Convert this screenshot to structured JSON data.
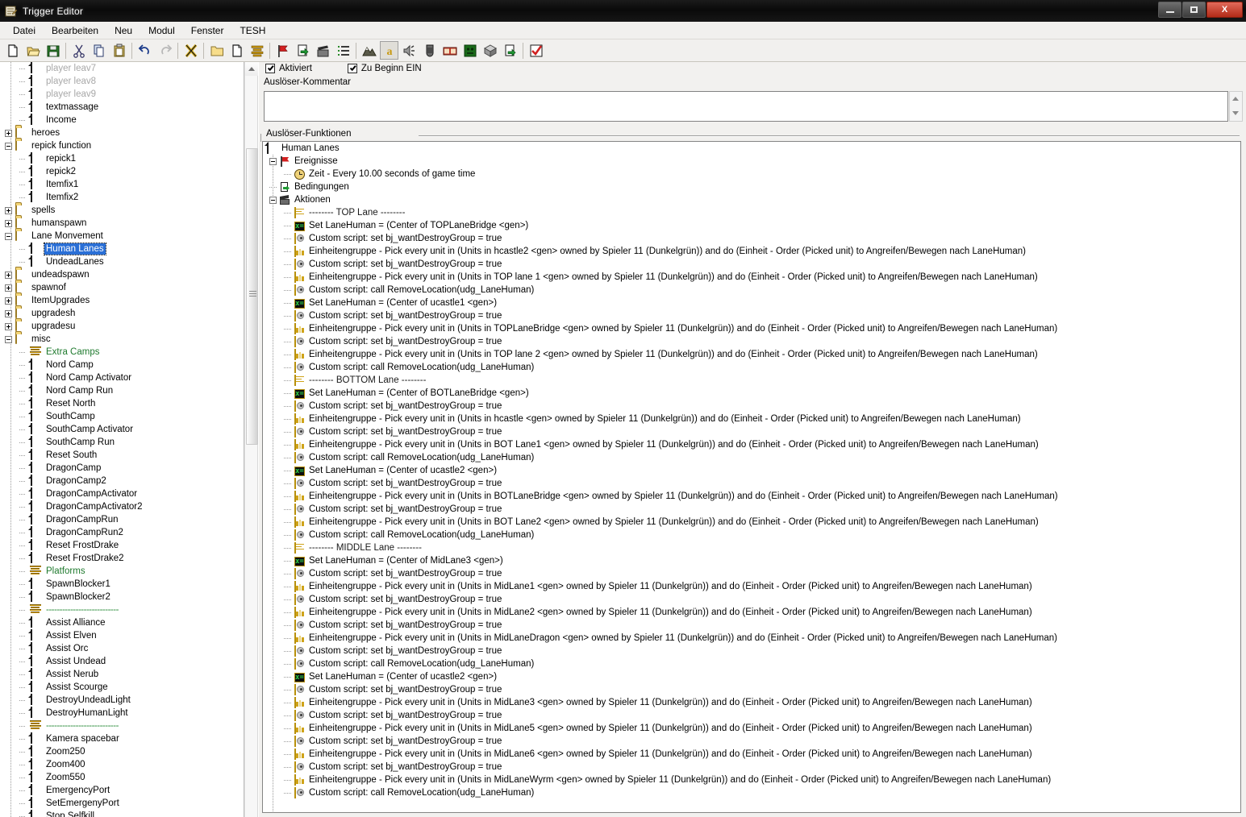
{
  "window": {
    "title": "Trigger Editor",
    "minimize_label": "Minimize",
    "maximize_label": "Maximize",
    "close_label": "X"
  },
  "menubar": {
    "items": [
      "Datei",
      "Bearbeiten",
      "Neu",
      "Modul",
      "Fenster",
      "TESH"
    ]
  },
  "toolbar": {
    "buttons": [
      {
        "name": "new-icon",
        "glyph": "page"
      },
      {
        "name": "open-icon",
        "glyph": "folder-open"
      },
      {
        "name": "save-icon",
        "glyph": "floppy"
      },
      {
        "name": "cut-icon",
        "glyph": "scissors"
      },
      {
        "name": "copy-icon",
        "glyph": "copy"
      },
      {
        "name": "paste-icon",
        "glyph": "clipboard"
      },
      {
        "name": "undo-icon",
        "glyph": "undo"
      },
      {
        "name": "redo-icon",
        "glyph": "redo"
      },
      {
        "name": "close-x-icon",
        "glyph": "x"
      },
      {
        "name": "new-category-icon",
        "glyph": "folder"
      },
      {
        "name": "new-trigger-icon",
        "glyph": "page2"
      },
      {
        "name": "new-comment-icon",
        "glyph": "lines"
      },
      {
        "name": "new-event-icon",
        "glyph": "flag"
      },
      {
        "name": "new-condition-icon",
        "glyph": "cond"
      },
      {
        "name": "new-action-icon",
        "glyph": "act"
      },
      {
        "name": "script-list-icon",
        "glyph": "list"
      },
      {
        "name": "terrain-editor-icon",
        "glyph": "mountain"
      },
      {
        "name": "trigger-editor-icon",
        "glyph": "letter-a"
      },
      {
        "name": "sound-editor-icon",
        "glyph": "speaker"
      },
      {
        "name": "object-editor-icon",
        "glyph": "helmet"
      },
      {
        "name": "campaign-editor-icon",
        "glyph": "book"
      },
      {
        "name": "ai-editor-icon",
        "glyph": "face"
      },
      {
        "name": "object-manager-icon",
        "glyph": "cube"
      },
      {
        "name": "import-manager-icon",
        "glyph": "import"
      },
      {
        "name": "test-map-icon",
        "glyph": "check"
      }
    ]
  },
  "tree": {
    "items": [
      {
        "label": "player leav7",
        "icon": "doc",
        "depth": 3,
        "state": "dim"
      },
      {
        "label": "player leav8",
        "icon": "doc",
        "depth": 3,
        "state": "dim"
      },
      {
        "label": "player leav9",
        "icon": "doc",
        "depth": 3,
        "state": "dim"
      },
      {
        "label": "textmassage",
        "icon": "doc",
        "depth": 3,
        "state": "normal"
      },
      {
        "label": "Income",
        "icon": "doc",
        "depth": 3,
        "state": "normal"
      },
      {
        "label": "heroes",
        "icon": "folder",
        "depth": 1,
        "state": "normal",
        "toggle": "plus"
      },
      {
        "label": "repick function",
        "icon": "folder-open",
        "depth": 1,
        "state": "normal",
        "toggle": "minus"
      },
      {
        "label": "repick1",
        "icon": "doc",
        "depth": 3,
        "state": "normal"
      },
      {
        "label": "repick2",
        "icon": "doc",
        "depth": 3,
        "state": "normal"
      },
      {
        "label": "Itemfix1",
        "icon": "doc",
        "depth": 3,
        "state": "normal"
      },
      {
        "label": "Itemfix2",
        "icon": "doc",
        "depth": 3,
        "state": "normal"
      },
      {
        "label": "spells",
        "icon": "folder",
        "depth": 1,
        "state": "normal",
        "toggle": "plus"
      },
      {
        "label": "humanspawn",
        "icon": "folder",
        "depth": 1,
        "state": "normal",
        "toggle": "plus"
      },
      {
        "label": "Lane Monvement",
        "icon": "folder-open",
        "depth": 1,
        "state": "normal",
        "toggle": "minus"
      },
      {
        "label": "Human Lanes",
        "icon": "doc",
        "depth": 3,
        "state": "selected"
      },
      {
        "label": "UndeadLanes",
        "icon": "doc",
        "depth": 3,
        "state": "normal"
      },
      {
        "label": "undeadspawn",
        "icon": "folder",
        "depth": 1,
        "state": "normal",
        "toggle": "plus"
      },
      {
        "label": "spawnof",
        "icon": "folder",
        "depth": 1,
        "state": "normal",
        "toggle": "plus"
      },
      {
        "label": "ItemUpgrades",
        "icon": "folder",
        "depth": 1,
        "state": "normal",
        "toggle": "plus"
      },
      {
        "label": "upgradesh",
        "icon": "folder",
        "depth": 1,
        "state": "normal",
        "toggle": "plus"
      },
      {
        "label": "upgradesu",
        "icon": "folder",
        "depth": 1,
        "state": "normal",
        "toggle": "plus"
      },
      {
        "label": "misc",
        "icon": "folder-open",
        "depth": 1,
        "state": "normal",
        "toggle": "minus"
      },
      {
        "label": "Extra Camps",
        "icon": "comment",
        "depth": 3,
        "state": "green"
      },
      {
        "label": "Nord Camp",
        "icon": "doc",
        "depth": 3,
        "state": "normal"
      },
      {
        "label": "Nord Camp Activator",
        "icon": "doc",
        "depth": 3,
        "state": "normal"
      },
      {
        "label": "Nord Camp Run",
        "icon": "doc",
        "depth": 3,
        "state": "normal"
      },
      {
        "label": "Reset North",
        "icon": "doc",
        "depth": 3,
        "state": "normal"
      },
      {
        "label": "SouthCamp",
        "icon": "doc",
        "depth": 3,
        "state": "normal"
      },
      {
        "label": "SouthCamp Activator",
        "icon": "doc",
        "depth": 3,
        "state": "normal"
      },
      {
        "label": "SouthCamp Run",
        "icon": "doc",
        "depth": 3,
        "state": "normal"
      },
      {
        "label": "Reset South",
        "icon": "doc",
        "depth": 3,
        "state": "normal"
      },
      {
        "label": "DragonCamp",
        "icon": "doc",
        "depth": 3,
        "state": "normal"
      },
      {
        "label": "DragonCamp2",
        "icon": "doc",
        "depth": 3,
        "state": "normal"
      },
      {
        "label": "DragonCampActivator",
        "icon": "doc",
        "depth": 3,
        "state": "normal"
      },
      {
        "label": "DragonCampActivator2",
        "icon": "doc",
        "depth": 3,
        "state": "normal"
      },
      {
        "label": "DragonCampRun",
        "icon": "doc",
        "depth": 3,
        "state": "normal"
      },
      {
        "label": "DragonCampRun2",
        "icon": "doc",
        "depth": 3,
        "state": "normal"
      },
      {
        "label": "Reset FrostDrake",
        "icon": "doc",
        "depth": 3,
        "state": "normal"
      },
      {
        "label": "Reset FrostDrake2",
        "icon": "doc",
        "depth": 3,
        "state": "normal"
      },
      {
        "label": "Platforms",
        "icon": "comment",
        "depth": 3,
        "state": "green"
      },
      {
        "label": "SpawnBlocker1",
        "icon": "doc",
        "depth": 3,
        "state": "normal"
      },
      {
        "label": "SpawnBlocker2",
        "icon": "doc",
        "depth": 3,
        "state": "normal"
      },
      {
        "label": "---------------------------",
        "icon": "comment",
        "depth": 3,
        "state": "sep"
      },
      {
        "label": "Assist Alliance",
        "icon": "doc",
        "depth": 3,
        "state": "normal"
      },
      {
        "label": "Assist Elven",
        "icon": "doc",
        "depth": 3,
        "state": "normal"
      },
      {
        "label": "Assist Orc",
        "icon": "doc",
        "depth": 3,
        "state": "normal"
      },
      {
        "label": "Assist Undead",
        "icon": "doc",
        "depth": 3,
        "state": "normal"
      },
      {
        "label": "Assist Nerub",
        "icon": "doc",
        "depth": 3,
        "state": "normal"
      },
      {
        "label": "Assist Scourge",
        "icon": "doc",
        "depth": 3,
        "state": "normal"
      },
      {
        "label": "DestroyUndeadLight",
        "icon": "doc",
        "depth": 3,
        "state": "normal"
      },
      {
        "label": "DestroyHumanLight",
        "icon": "doc",
        "depth": 3,
        "state": "normal"
      },
      {
        "label": "---------------------------",
        "icon": "comment",
        "depth": 3,
        "state": "sep"
      },
      {
        "label": "Kamera spacebar",
        "icon": "doc",
        "depth": 3,
        "state": "normal"
      },
      {
        "label": "Zoom250",
        "icon": "doc",
        "depth": 3,
        "state": "normal"
      },
      {
        "label": "Zoom400",
        "icon": "doc",
        "depth": 3,
        "state": "normal"
      },
      {
        "label": "Zoom550",
        "icon": "doc",
        "depth": 3,
        "state": "normal"
      },
      {
        "label": "EmergencyPort",
        "icon": "doc",
        "depth": 3,
        "state": "normal"
      },
      {
        "label": "SetEmergenyPort",
        "icon": "doc",
        "depth": 3,
        "state": "normal"
      },
      {
        "label": "Stop Selfkill",
        "icon": "doc",
        "depth": 3,
        "state": "normal"
      }
    ]
  },
  "detail": {
    "enabled_checkbox_label": "Aktiviert",
    "initially_on_checkbox_label": "Zu Beginn EIN",
    "comment_label": "Auslöser-Kommentar",
    "comment_value": "",
    "functions_group_label": "Auslöser-Funktionen",
    "functions": [
      {
        "icon": "doc",
        "indent": 0,
        "toggle": "none",
        "text": "Human Lanes"
      },
      {
        "icon": "flag",
        "indent": 1,
        "toggle": "minus",
        "text": "Ereignisse"
      },
      {
        "icon": "clock",
        "indent": 3,
        "toggle": "none",
        "text": "Zeit - Every 10.00 seconds of game time"
      },
      {
        "icon": "cond",
        "indent": 1,
        "toggle": "none",
        "text": "Bedingungen"
      },
      {
        "icon": "act",
        "indent": 1,
        "toggle": "minus",
        "text": "Aktionen"
      },
      {
        "icon": "cmt",
        "indent": 3,
        "toggle": "none",
        "text": "-------- TOP Lane --------"
      },
      {
        "icon": "var",
        "indent": 3,
        "toggle": "none",
        "text": "Set LaneHuman = (Center of TOPLaneBridge <gen>)"
      },
      {
        "icon": "script",
        "indent": 3,
        "toggle": "none",
        "text": "Custom script:   set bj_wantDestroyGroup = true"
      },
      {
        "icon": "grp",
        "indent": 3,
        "toggle": "none",
        "text": "Einheitengruppe - Pick every unit in (Units in hcastle2 <gen> owned by Spieler 11 (Dunkelgrün)) and do (Einheit - Order (Picked unit) to Angreifen/Bewegen nach LaneHuman)"
      },
      {
        "icon": "script",
        "indent": 3,
        "toggle": "none",
        "text": "Custom script:   set bj_wantDestroyGroup = true"
      },
      {
        "icon": "grp",
        "indent": 3,
        "toggle": "none",
        "text": "Einheitengruppe - Pick every unit in (Units in TOP lane 1 <gen> owned by Spieler 11 (Dunkelgrün)) and do (Einheit - Order (Picked unit) to Angreifen/Bewegen nach LaneHuman)"
      },
      {
        "icon": "script",
        "indent": 3,
        "toggle": "none",
        "text": "Custom script:   call RemoveLocation(udg_LaneHuman)"
      },
      {
        "icon": "var",
        "indent": 3,
        "toggle": "none",
        "text": "Set LaneHuman = (Center of ucastle1 <gen>)"
      },
      {
        "icon": "script",
        "indent": 3,
        "toggle": "none",
        "text": "Custom script:   set bj_wantDestroyGroup = true"
      },
      {
        "icon": "grp",
        "indent": 3,
        "toggle": "none",
        "text": "Einheitengruppe - Pick every unit in (Units in TOPLaneBridge <gen> owned by Spieler 11 (Dunkelgrün)) and do (Einheit - Order (Picked unit) to Angreifen/Bewegen nach LaneHuman)"
      },
      {
        "icon": "script",
        "indent": 3,
        "toggle": "none",
        "text": "Custom script:   set bj_wantDestroyGroup = true"
      },
      {
        "icon": "grp",
        "indent": 3,
        "toggle": "none",
        "text": "Einheitengruppe - Pick every unit in (Units in TOP lane 2 <gen> owned by Spieler 11 (Dunkelgrün)) and do (Einheit - Order (Picked unit) to Angreifen/Bewegen nach LaneHuman)"
      },
      {
        "icon": "script",
        "indent": 3,
        "toggle": "none",
        "text": "Custom script:   call RemoveLocation(udg_LaneHuman)"
      },
      {
        "icon": "cmt",
        "indent": 3,
        "toggle": "none",
        "text": "-------- BOTTOM Lane --------"
      },
      {
        "icon": "var",
        "indent": 3,
        "toggle": "none",
        "text": "Set LaneHuman = (Center of BOTLaneBridge <gen>)"
      },
      {
        "icon": "script",
        "indent": 3,
        "toggle": "none",
        "text": "Custom script:   set bj_wantDestroyGroup = true"
      },
      {
        "icon": "grp",
        "indent": 3,
        "toggle": "none",
        "text": "Einheitengruppe - Pick every unit in (Units in hcastle <gen> owned by Spieler 11 (Dunkelgrün)) and do (Einheit - Order (Picked unit) to Angreifen/Bewegen nach LaneHuman)"
      },
      {
        "icon": "script",
        "indent": 3,
        "toggle": "none",
        "text": "Custom script:   set bj_wantDestroyGroup = true"
      },
      {
        "icon": "grp",
        "indent": 3,
        "toggle": "none",
        "text": "Einheitengruppe - Pick every unit in (Units in BOT Lane1 <gen> owned by Spieler 11 (Dunkelgrün)) and do (Einheit - Order (Picked unit) to Angreifen/Bewegen nach LaneHuman)"
      },
      {
        "icon": "script",
        "indent": 3,
        "toggle": "none",
        "text": "Custom script:   call RemoveLocation(udg_LaneHuman)"
      },
      {
        "icon": "var",
        "indent": 3,
        "toggle": "none",
        "text": "Set LaneHuman = (Center of ucastle2 <gen>)"
      },
      {
        "icon": "script",
        "indent": 3,
        "toggle": "none",
        "text": "Custom script:   set bj_wantDestroyGroup = true"
      },
      {
        "icon": "grp",
        "indent": 3,
        "toggle": "none",
        "text": "Einheitengruppe - Pick every unit in (Units in BOTLaneBridge <gen> owned by Spieler 11 (Dunkelgrün)) and do (Einheit - Order (Picked unit) to Angreifen/Bewegen nach LaneHuman)"
      },
      {
        "icon": "script",
        "indent": 3,
        "toggle": "none",
        "text": "Custom script:   set bj_wantDestroyGroup = true"
      },
      {
        "icon": "grp",
        "indent": 3,
        "toggle": "none",
        "text": "Einheitengruppe - Pick every unit in (Units in BOT Lane2 <gen> owned by Spieler 11 (Dunkelgrün)) and do (Einheit - Order (Picked unit) to Angreifen/Bewegen nach LaneHuman)"
      },
      {
        "icon": "script",
        "indent": 3,
        "toggle": "none",
        "text": "Custom script:   call RemoveLocation(udg_LaneHuman)"
      },
      {
        "icon": "cmt",
        "indent": 3,
        "toggle": "none",
        "text": "-------- MIDDLE Lane --------"
      },
      {
        "icon": "var",
        "indent": 3,
        "toggle": "none",
        "text": "Set LaneHuman = (Center of MidLane3 <gen>)"
      },
      {
        "icon": "script",
        "indent": 3,
        "toggle": "none",
        "text": "Custom script:   set bj_wantDestroyGroup = true"
      },
      {
        "icon": "grp",
        "indent": 3,
        "toggle": "none",
        "text": "Einheitengruppe - Pick every unit in (Units in MidLane1 <gen> owned by Spieler 11 (Dunkelgrün)) and do (Einheit - Order (Picked unit) to Angreifen/Bewegen nach LaneHuman)"
      },
      {
        "icon": "script",
        "indent": 3,
        "toggle": "none",
        "text": "Custom script:   set bj_wantDestroyGroup = true"
      },
      {
        "icon": "grp",
        "indent": 3,
        "toggle": "none",
        "text": "Einheitengruppe - Pick every unit in (Units in MidLane2 <gen> owned by Spieler 11 (Dunkelgrün)) and do (Einheit - Order (Picked unit) to Angreifen/Bewegen nach LaneHuman)"
      },
      {
        "icon": "script",
        "indent": 3,
        "toggle": "none",
        "text": "Custom script:   set bj_wantDestroyGroup = true"
      },
      {
        "icon": "grp",
        "indent": 3,
        "toggle": "none",
        "text": "Einheitengruppe - Pick every unit in (Units in MidLaneDragon <gen> owned by Spieler 11 (Dunkelgrün)) and do (Einheit - Order (Picked unit) to Angreifen/Bewegen nach LaneHuman)"
      },
      {
        "icon": "script",
        "indent": 3,
        "toggle": "none",
        "text": "Custom script:   set bj_wantDestroyGroup = true"
      },
      {
        "icon": "script",
        "indent": 3,
        "toggle": "none",
        "text": "Custom script:   call RemoveLocation(udg_LaneHuman)"
      },
      {
        "icon": "var",
        "indent": 3,
        "toggle": "none",
        "text": "Set LaneHuman = (Center of ucastle2 <gen>)"
      },
      {
        "icon": "script",
        "indent": 3,
        "toggle": "none",
        "text": "Custom script:   set bj_wantDestroyGroup = true"
      },
      {
        "icon": "grp",
        "indent": 3,
        "toggle": "none",
        "text": "Einheitengruppe - Pick every unit in (Units in MidLane3 <gen> owned by Spieler 11 (Dunkelgrün)) and do (Einheit - Order (Picked unit) to Angreifen/Bewegen nach LaneHuman)"
      },
      {
        "icon": "script",
        "indent": 3,
        "toggle": "none",
        "text": "Custom script:   set bj_wantDestroyGroup = true"
      },
      {
        "icon": "grp",
        "indent": 3,
        "toggle": "none",
        "text": "Einheitengruppe - Pick every unit in (Units in MidLane5 <gen> owned by Spieler 11 (Dunkelgrün)) and do (Einheit - Order (Picked unit) to Angreifen/Bewegen nach LaneHuman)"
      },
      {
        "icon": "script",
        "indent": 3,
        "toggle": "none",
        "text": "Custom script:   set bj_wantDestroyGroup = true"
      },
      {
        "icon": "grp",
        "indent": 3,
        "toggle": "none",
        "text": "Einheitengruppe - Pick every unit in (Units in MidLane6 <gen> owned by Spieler 11 (Dunkelgrün)) and do (Einheit - Order (Picked unit) to Angreifen/Bewegen nach LaneHuman)"
      },
      {
        "icon": "script",
        "indent": 3,
        "toggle": "none",
        "text": "Custom script:   set bj_wantDestroyGroup = true"
      },
      {
        "icon": "grp",
        "indent": 3,
        "toggle": "none",
        "text": "Einheitengruppe - Pick every unit in (Units in MidLaneWyrm <gen> owned by Spieler 11 (Dunkelgrün)) and do (Einheit - Order (Picked unit) to Angreifen/Bewegen nach LaneHuman)"
      },
      {
        "icon": "script",
        "indent": 3,
        "toggle": "none",
        "text": "Custom script:   call RemoveLocation(udg_LaneHuman)"
      }
    ]
  },
  "colors": {
    "selection_blue": "#2a6fd6",
    "comment_green": "#1f7a2e",
    "titlebar_black": "#0a0a0a",
    "chrome_gray": "#f1f0ee"
  }
}
